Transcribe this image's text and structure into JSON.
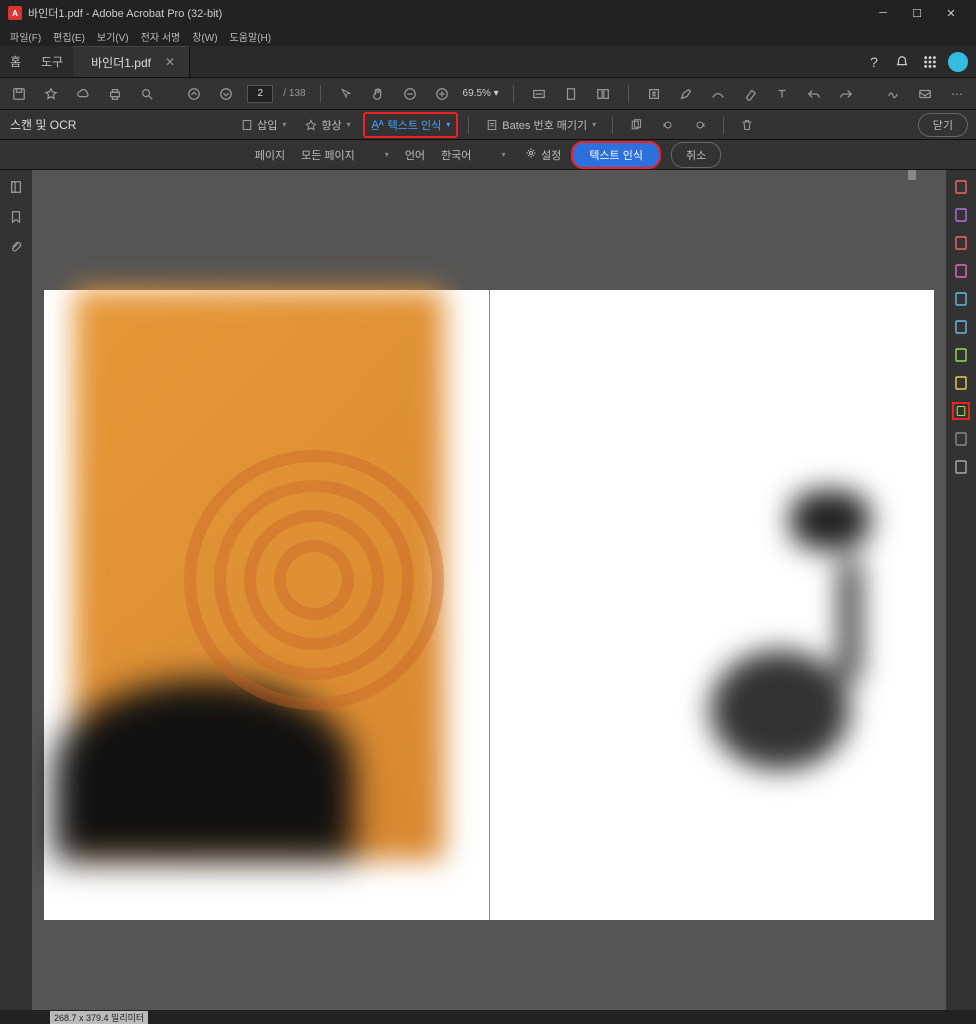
{
  "title": "바인더1.pdf - Adobe Acrobat Pro (32-bit)",
  "menu": {
    "file": "파일(F)",
    "edit": "편집(E)",
    "view": "보기(V)",
    "sign": "전자 서명",
    "window": "창(W)",
    "help": "도움말(H)"
  },
  "tabs": {
    "home": "홈",
    "tools": "도구",
    "doc": "바인더1.pdf"
  },
  "page": {
    "current": "2",
    "total": "138"
  },
  "zoom": {
    "pct": "69.5%"
  },
  "scan_ocr": {
    "tool_name": "스캔 및 OCR",
    "insert": "삽입",
    "enhance": "향상",
    "text_recognize": "텍스트 인식",
    "bates": "Bates 번호 매기기",
    "close": "닫기"
  },
  "subbar": {
    "page_label": "페이지",
    "page_value": "모든 페이지",
    "lang_label": "언어",
    "lang_value": "한국어",
    "settings": "설정",
    "primary": "텍스트 인식",
    "cancel": "취소"
  },
  "status": {
    "dims": "268.7 x 379.4 밀리미터"
  },
  "right_tools": [
    {
      "id": "create",
      "color": "#e66"
    },
    {
      "id": "combine",
      "color": "#b66ce6"
    },
    {
      "id": "organize",
      "color": "#e66"
    },
    {
      "id": "edit",
      "color": "#e6b"
    },
    {
      "id": "fill-sign",
      "color": "#6bd"
    },
    {
      "id": "export",
      "color": "#6bd"
    },
    {
      "id": "compress",
      "color": "#9d5"
    },
    {
      "id": "comment",
      "color": "#ec5"
    },
    {
      "id": "scan-ocr",
      "color": "#9d5"
    },
    {
      "id": "protect",
      "color": "#888"
    },
    {
      "id": "redact",
      "color": "#aaa"
    }
  ]
}
